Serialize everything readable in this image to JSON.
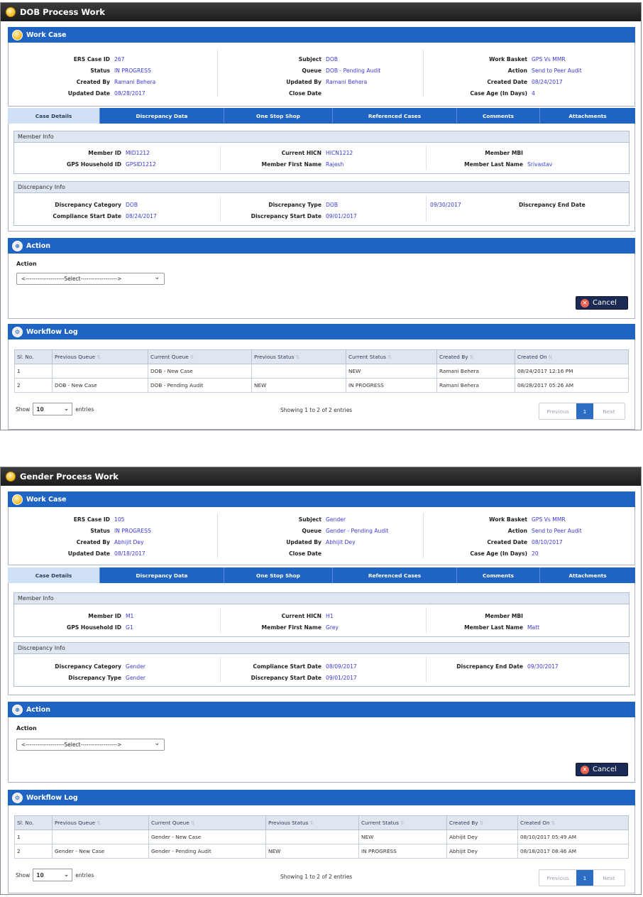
{
  "screens": [
    {
      "title": "DOB Process Work",
      "work_case": {
        "heading": "Work Case",
        "col1": [
          {
            "k": "ERS Case ID",
            "v": "267"
          },
          {
            "k": "Status",
            "v": "IN PROGRESS"
          },
          {
            "k": "Created By",
            "v": "Ramani Behera"
          },
          {
            "k": "Updated Date",
            "v": "08/28/2017"
          }
        ],
        "col2": [
          {
            "k": "Subject",
            "v": "DOB"
          },
          {
            "k": "Queue",
            "v": "DOB - Pending Audit"
          },
          {
            "k": "Updated By",
            "v": "Ramani Behera"
          },
          {
            "k": "Close Date",
            "v": ""
          }
        ],
        "col3": [
          {
            "k": "Work Basket",
            "v": "GPS Vs MMR"
          },
          {
            "k": "Action",
            "v": "Send to Peer Audit"
          },
          {
            "k": "Created Date",
            "v": "08/24/2017"
          },
          {
            "k": "Case Age (In Days)",
            "v": "4"
          }
        ]
      },
      "tabs": [
        "Case Details",
        "Discrepancy Data",
        "One Stop Shop",
        "Referenced Cases",
        "Comments",
        "Attachments"
      ],
      "member_info": {
        "heading": "Member Info",
        "col1": [
          {
            "k": "Member ID",
            "v": "MID1212"
          },
          {
            "k": "GPS Household ID",
            "v": "GPSID1212"
          }
        ],
        "col2": [
          {
            "k": "Current HICN",
            "v": "HICN1212"
          },
          {
            "k": "Member First Name",
            "v": "Rajesh"
          }
        ],
        "col3": [
          {
            "k": "Member MBI",
            "v": ""
          },
          {
            "k": "Member Last Name",
            "v": "Srivastav"
          }
        ]
      },
      "discrepancy_info": {
        "heading": "Discrepancy Info",
        "col1": [
          {
            "k": "Discrepancy Category",
            "v": "DOB"
          },
          {
            "k": "Compliance Start Date",
            "v": "08/24/2017"
          }
        ],
        "col2": [
          {
            "k": "Discrepancy Type",
            "v": "DOB"
          },
          {
            "k": "Discrepancy Start Date",
            "v": "09/01/2017"
          }
        ],
        "col3": [
          {
            "k": "",
            "v": "09/30/2017"
          },
          {
            "k": "",
            "v": ""
          }
        ],
        "col4": [
          {
            "k": "Discrepancy End Date",
            "v": ""
          },
          {
            "k": "",
            "v": ""
          }
        ]
      },
      "action": {
        "heading": "Action",
        "label": "Action",
        "select": "<--------------------Select------------------->",
        "cancel": "Cancel"
      },
      "workflow": {
        "heading": "Workflow Log",
        "columns": [
          "Sl. No.",
          "Previous Queue",
          "Current Queue",
          "Previous Status",
          "Current Status",
          "Created By",
          "Created On"
        ],
        "rows": [
          [
            "1",
            "",
            "DOB - New Case",
            "",
            "NEW",
            "Ramani Behera",
            "08/24/2017 12:16 PM"
          ],
          [
            "2",
            "DOB - New Case",
            "DOB - Pending Audit",
            "NEW",
            "IN PROGRESS",
            "Ramani Behera",
            "08/28/2017 05:26 AM"
          ]
        ],
        "show": "Show",
        "entries_value": "10",
        "entries": "entries",
        "info": "Showing 1 to 2 of 2 entries",
        "prev": "Previous",
        "page": "1",
        "next": "Next"
      }
    },
    {
      "title": "Gender Process Work",
      "work_case": {
        "heading": "Work Case",
        "col1": [
          {
            "k": "ERS Case ID",
            "v": "105"
          },
          {
            "k": "Status",
            "v": "IN PROGRESS"
          },
          {
            "k": "Created By",
            "v": "Abhijit Dey"
          },
          {
            "k": "Updated Date",
            "v": "08/18/2017"
          }
        ],
        "col2": [
          {
            "k": "Subject",
            "v": "Gender"
          },
          {
            "k": "Queue",
            "v": "Gender - Pending Audit"
          },
          {
            "k": "Updated By",
            "v": "Abhijit Dey"
          },
          {
            "k": "Close Date",
            "v": ""
          }
        ],
        "col3": [
          {
            "k": "Work Basket",
            "v": "GPS Vs MMR"
          },
          {
            "k": "Action",
            "v": "Send to Peer Audit"
          },
          {
            "k": "Created Date",
            "v": "08/10/2017"
          },
          {
            "k": "Case Age (In Days)",
            "v": "20"
          }
        ]
      },
      "tabs": [
        "Case Details",
        "Discrepancy Data",
        "One Stop Shop",
        "Referenced Cases",
        "Comments",
        "Attachments"
      ],
      "member_info": {
        "heading": "Member Info",
        "col1": [
          {
            "k": "Member ID",
            "v": "M1"
          },
          {
            "k": "GPS Household ID",
            "v": "G1"
          }
        ],
        "col2": [
          {
            "k": "Current HICN",
            "v": "H1"
          },
          {
            "k": "Member First Name",
            "v": "Grey"
          }
        ],
        "col3": [
          {
            "k": "Member MBI",
            "v": ""
          },
          {
            "k": "Member Last Name",
            "v": "Matt"
          }
        ]
      },
      "discrepancy_info": {
        "heading": "Discrepancy Info",
        "col1": [
          {
            "k": "Discrepancy Category",
            "v": "Gender"
          },
          {
            "k": "Discrepancy Type",
            "v": "Gender"
          }
        ],
        "col2": [
          {
            "k": "Compliance Start Date",
            "v": "08/09/2017"
          },
          {
            "k": "Discrepancy Start Date",
            "v": "09/01/2017"
          }
        ],
        "col3": [
          {
            "k": "Discrepancy End Date",
            "v": "09/30/2017"
          },
          {
            "k": "",
            "v": ""
          }
        ]
      },
      "action": {
        "heading": "Action",
        "label": "Action",
        "select": "<--------------------Select------------------->",
        "cancel": "Cancel"
      },
      "workflow": {
        "heading": "Workflow Log",
        "columns": [
          "Sl. No.",
          "Previous Queue",
          "Current Queue",
          "Previous Status",
          "Current Status",
          "Created By",
          "Created On"
        ],
        "rows": [
          [
            "1",
            "",
            "Gender - New Case",
            "",
            "NEW",
            "Abhijit Dey",
            "08/10/2017 05:49 AM"
          ],
          [
            "2",
            "Gender - New Case",
            "Gender - Pending Audit",
            "NEW",
            "IN PROGRESS",
            "Abhijit Dey",
            "08/18/2017 08:46 AM"
          ]
        ],
        "show": "Show",
        "entries_value": "10",
        "entries": "entries",
        "info": "Showing 1 to 2 of 2 entries",
        "prev": "Previous",
        "page": "1",
        "next": "Next"
      }
    }
  ]
}
